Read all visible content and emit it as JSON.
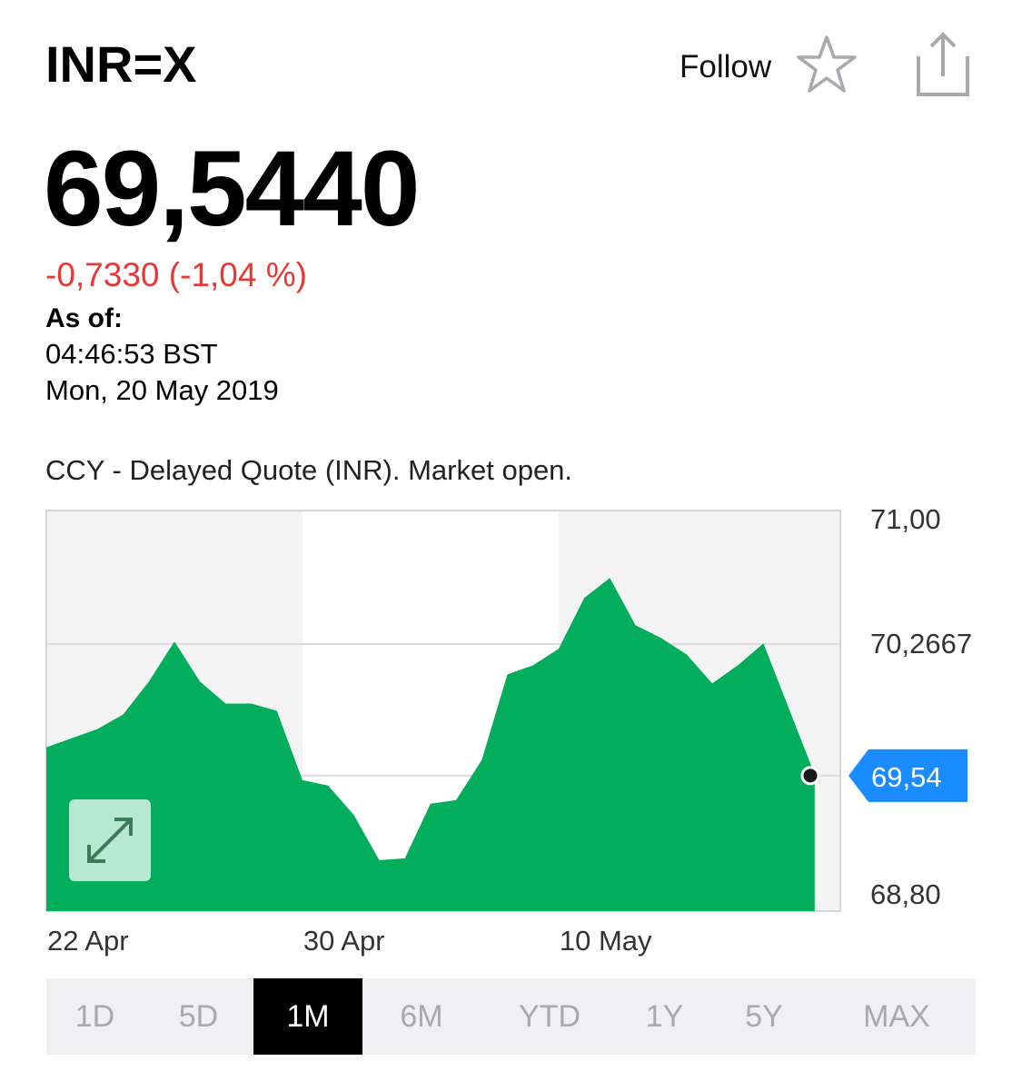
{
  "header": {
    "ticker": "INR=X",
    "follow_label": "Follow"
  },
  "quote": {
    "price": "69,5440",
    "change": "-0,7330 (-1,04 %)",
    "as_of_label": "As of:",
    "as_of_time": "04:46:53 BST",
    "as_of_date": "Mon, 20 May 2019",
    "note": "CCY - Delayed Quote (INR). Market open."
  },
  "colors": {
    "area_fill": "#02ad5b",
    "change_negative": "#e53935",
    "price_tag": "#1a8cff",
    "shade": "#f4f4f5"
  },
  "chart_data": {
    "type": "area",
    "y_ticks": [
      "71,00",
      "70,2667",
      "68,80"
    ],
    "x_ticks": [
      "22 Apr",
      "30 Apr",
      "10 May"
    ],
    "ylim": [
      68.8,
      71.0
    ],
    "current_value": 69.544,
    "current_label": "69,54",
    "grid": true,
    "x": [
      "2019-04-20",
      "2019-04-22",
      "2019-04-23",
      "2019-04-24",
      "2019-04-25",
      "2019-04-26",
      "2019-04-27",
      "2019-04-28",
      "2019-04-29",
      "2019-04-30",
      "2019-05-01",
      "2019-05-02",
      "2019-05-03",
      "2019-05-04",
      "2019-05-05",
      "2019-05-06",
      "2019-05-07",
      "2019-05-08",
      "2019-05-09",
      "2019-05-10",
      "2019-05-11",
      "2019-05-12",
      "2019-05-13",
      "2019-05-14",
      "2019-05-15",
      "2019-05-16",
      "2019-05-17",
      "2019-05-18",
      "2019-05-20"
    ],
    "values": [
      69.7,
      69.8,
      69.88,
      70.06,
      70.28,
      70.06,
      69.94,
      69.94,
      69.9,
      69.52,
      69.49,
      69.33,
      69.08,
      69.09,
      69.39,
      69.41,
      69.63,
      70.1,
      70.15,
      70.24,
      70.52,
      70.63,
      70.37,
      70.3,
      70.21,
      70.05,
      70.15,
      70.27,
      69.55
    ]
  },
  "chart_ui": {
    "expand_icon": "expand-diagonal-arrows-icon"
  },
  "range_tabs": [
    {
      "label": "1D",
      "active": false
    },
    {
      "label": "5D",
      "active": false
    },
    {
      "label": "1M",
      "active": true
    },
    {
      "label": "6M",
      "active": false
    },
    {
      "label": "YTD",
      "active": false
    },
    {
      "label": "1Y",
      "active": false
    },
    {
      "label": "5Y",
      "active": false
    },
    {
      "label": "MAX",
      "active": false
    }
  ]
}
